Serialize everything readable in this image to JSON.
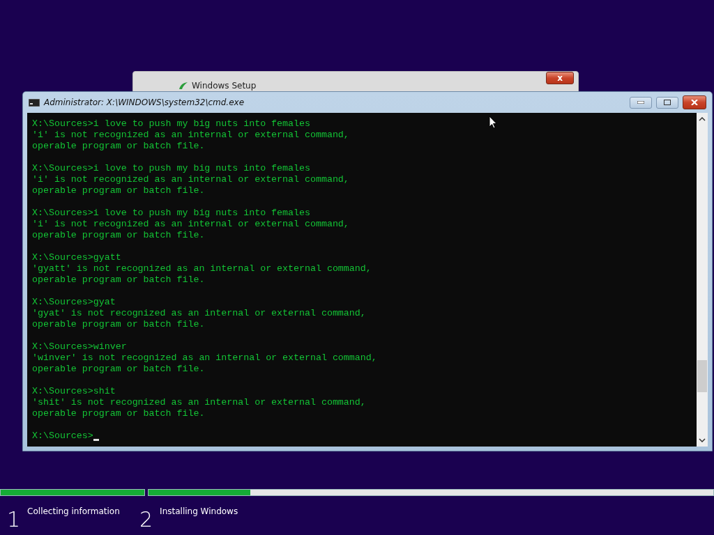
{
  "background_window": {
    "title": "Windows Setup",
    "close_label": "x"
  },
  "console": {
    "title": "Administrator: X:\\WINDOWS\\system32\\cmd.exe",
    "blocks": [
      {
        "lines": [
          "X:\\Sources>i love to push my big nuts into females",
          "'i' is not recognized as an internal or external command,",
          "operable program or batch file."
        ]
      },
      {
        "lines": [
          "X:\\Sources>i love to push my big nuts into females",
          "'i' is not recognized as an internal or external command,",
          "operable program or batch file."
        ]
      },
      {
        "lines": [
          "X:\\Sources>i love to push my big nuts into females",
          "'i' is not recognized as an internal or external command,",
          "operable program or batch file."
        ]
      },
      {
        "lines": [
          "X:\\Sources>gyatt",
          "'gyatt' is not recognized as an internal or external command,",
          "operable program or batch file."
        ]
      },
      {
        "lines": [
          "X:\\Sources>gyat",
          "'gyat' is not recognized as an internal or external command,",
          "operable program or batch file."
        ]
      },
      {
        "lines": [
          "X:\\Sources>winver",
          "'winver' is not recognized as an internal or external command,",
          "operable program or batch file."
        ]
      },
      {
        "lines": [
          "X:\\Sources>shit",
          "'shit' is not recognized as an internal or external command,",
          "operable program or batch file."
        ]
      }
    ],
    "prompt": "X:\\Sources>"
  },
  "steps": [
    {
      "number": "1",
      "label": "Collecting information",
      "level": 1
    },
    {
      "number": "2",
      "label": "Installing Windows",
      "level": 0.18
    }
  ]
}
